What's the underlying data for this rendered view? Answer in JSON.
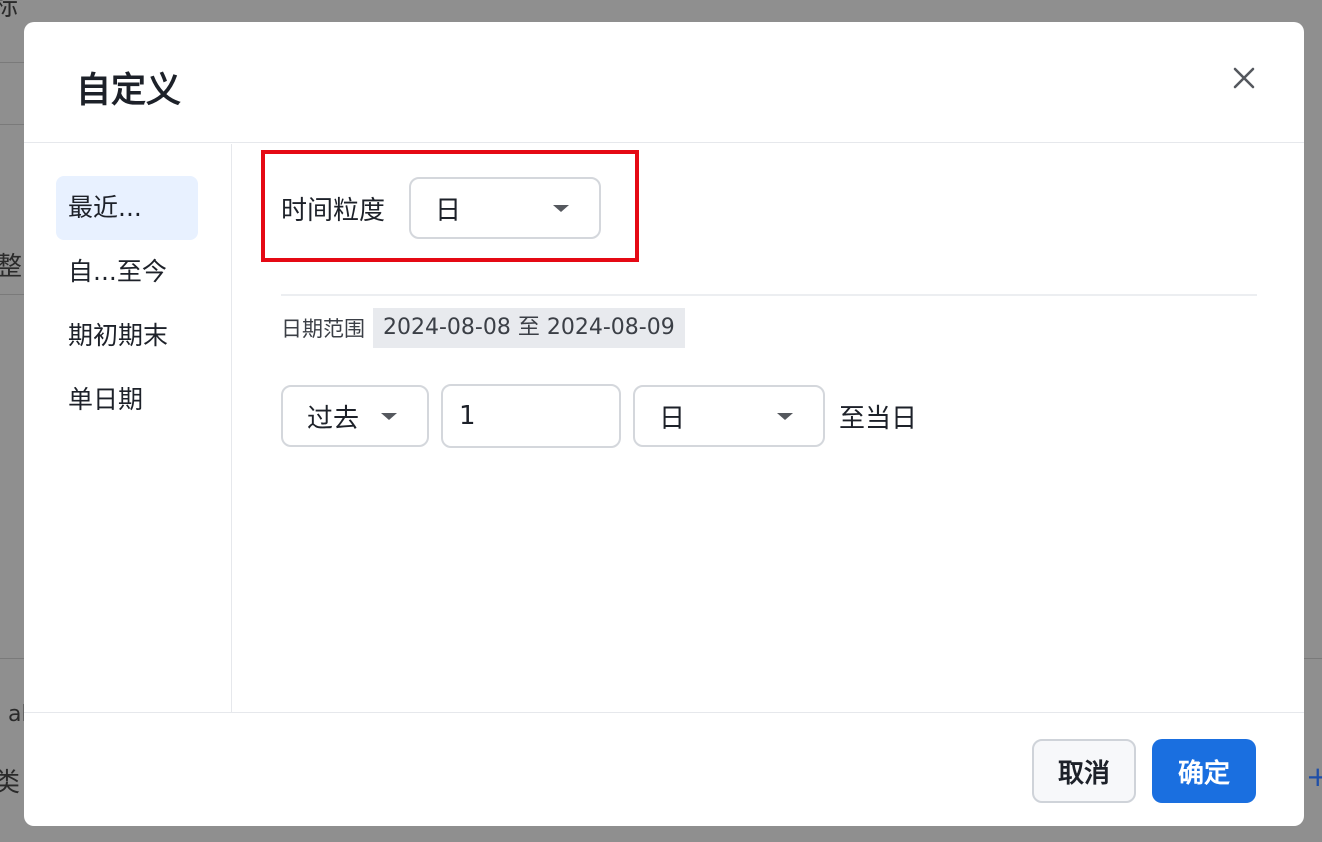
{
  "background": {
    "fragments": [
      "标",
      "整",
      "al",
      "类",
      "+"
    ]
  },
  "modal": {
    "title": "自定义",
    "sidebar": {
      "items": [
        {
          "label": "最近...",
          "active": true
        },
        {
          "label": "自...至今",
          "active": false
        },
        {
          "label": "期初期末",
          "active": false
        },
        {
          "label": "单日期",
          "active": false
        }
      ]
    },
    "granularity": {
      "label": "时间粒度",
      "value": "日"
    },
    "date_range": {
      "label": "日期范围",
      "value": "2024-08-08 至 2024-08-09"
    },
    "rule": {
      "direction": "过去",
      "count": "1",
      "unit": "日",
      "suffix": "至当日"
    },
    "footer": {
      "cancel_label": "取消",
      "ok_label": "确定"
    }
  },
  "colors": {
    "accent": "#1a6fe0",
    "highlight": "#e50914",
    "active_bg": "#e8f1ff"
  }
}
